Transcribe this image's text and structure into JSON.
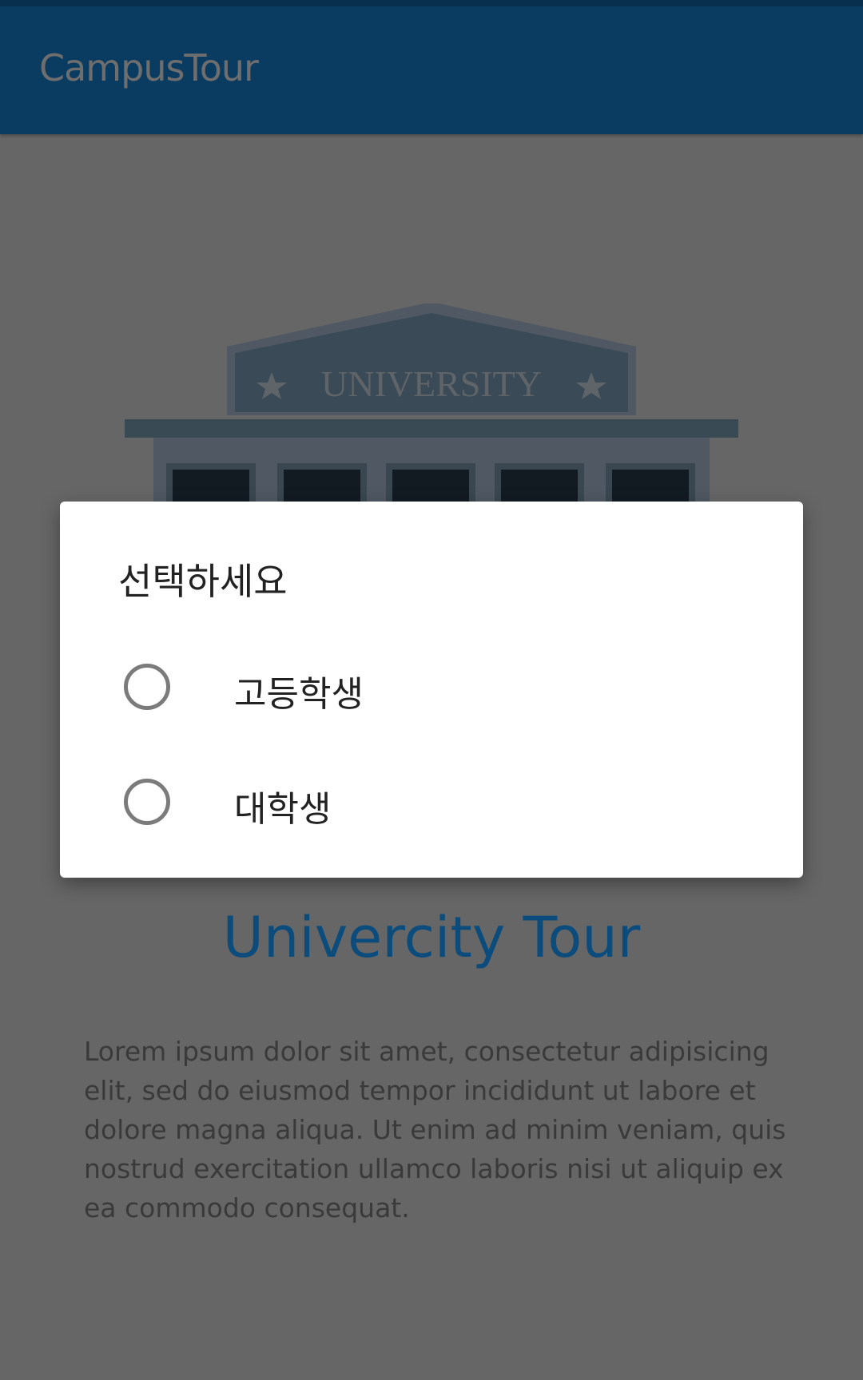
{
  "appbar": {
    "title": "CampusTour",
    "color": "#0a3b60"
  },
  "hero_image": {
    "sign_text": "UNIVERSITY",
    "icon": "university-building-illustration"
  },
  "main": {
    "title": "Univercity Tour",
    "title_color": "#0b4c7c",
    "body": "Lorem ipsum dolor sit amet, consectetur adipisicing elit, sed do eiusmod tempor incididunt ut labore et dolore magna aliqua. Ut enim ad minim veniam, quis nostrud exercitation ullamco laboris nisi ut aliquip ex ea commodo consequat."
  },
  "dialog": {
    "title": "선택하세요",
    "options": [
      {
        "label": "고등학생",
        "selected": false
      },
      {
        "label": "대학생",
        "selected": false
      }
    ]
  }
}
